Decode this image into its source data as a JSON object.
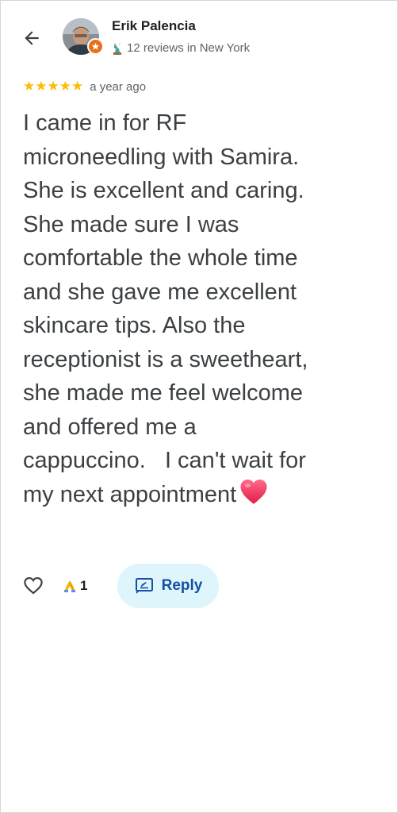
{
  "author": {
    "name": "Erik Palencia",
    "meta": "12 reviews in New York",
    "meta_icon": "statue-of-liberty-icon",
    "badge_icon": "local-guide-star-icon"
  },
  "review": {
    "stars": "★★★★★",
    "rating": 5,
    "time": "a year ago",
    "text": "I came in for RF\nmicroneedling with Samira.\nShe is excellent and caring.\nShe made sure I was\ncomfortable the whole time\nand she gave me excellent\nskincare tips. Also the\nreceptionist is a sweetheart,\nshe made me feel welcome\nand offered me a\ncappuccino.   I can't wait for\nmy next appointment",
    "trailing_emoji": "heart-emoji"
  },
  "actions": {
    "like_icon": "heart-outline-icon",
    "reaction_icon": "praying-hands-icon",
    "reaction_count": "1",
    "reply_label": "Reply",
    "reply_icon": "reply-icon"
  },
  "colors": {
    "star": "#fbbc04",
    "reply_bg": "#ddf5fb",
    "reply_text": "#174ea6",
    "badge": "#e8711a",
    "heart": "#e8375a"
  }
}
